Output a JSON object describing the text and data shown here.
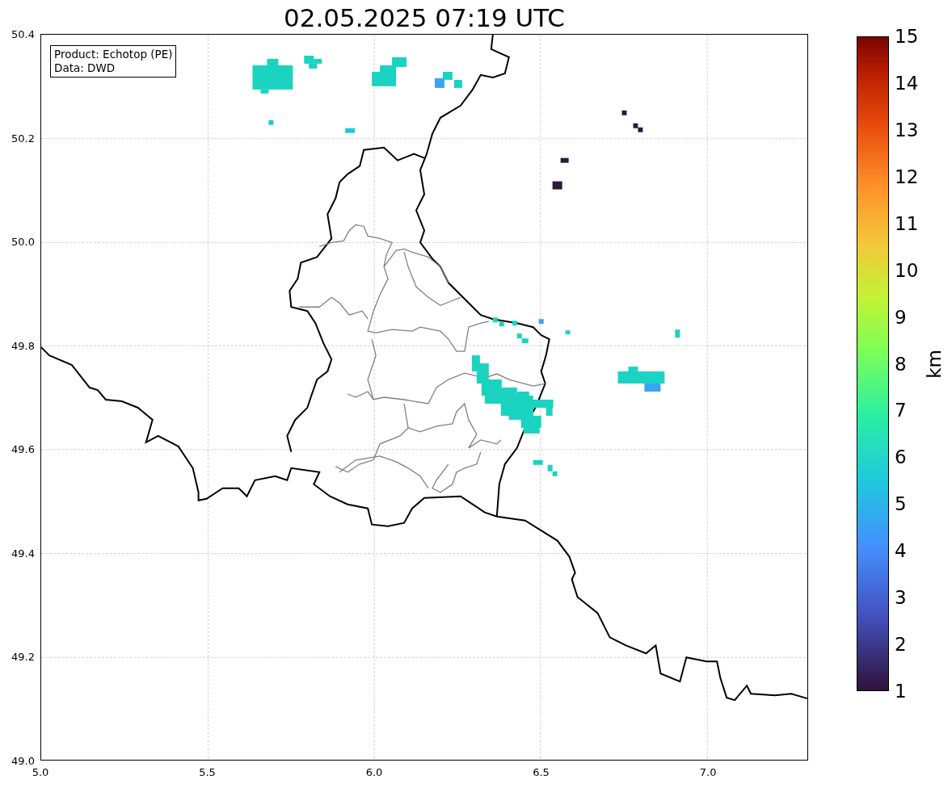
{
  "title": "02.05.2025 07:19 UTC",
  "info_box": [
    "Product: Echotop (PE)",
    "Data: DWD"
  ],
  "x_axis": {
    "ticks": [
      "5.0",
      "5.5",
      "6.0",
      "6.5",
      "7.0"
    ]
  },
  "y_axis": {
    "ticks": [
      "50.4",
      "50.2",
      "50.0",
      "49.8",
      "49.6",
      "49.4",
      "49.2",
      "49.0"
    ]
  },
  "colorbar": {
    "label": "km",
    "ticks": [
      "15",
      "14",
      "13",
      "12",
      "11",
      "10",
      "9",
      "8",
      "7",
      "6",
      "5",
      "4",
      "3",
      "2",
      "1"
    ]
  }
}
